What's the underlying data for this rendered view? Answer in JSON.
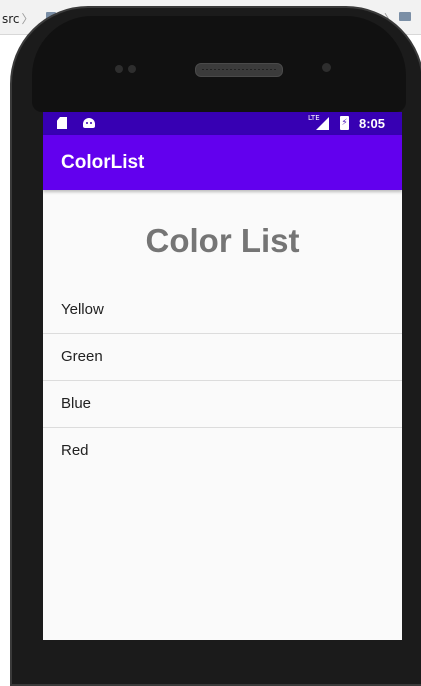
{
  "ide": {
    "breadcrumb": "src",
    "folder_icon": "folder-icon"
  },
  "status_bar": {
    "time": "8:05",
    "network": "LTE",
    "icons": [
      "sim-card-icon",
      "android-debug-icon",
      "signal-icon",
      "battery-charging-icon"
    ]
  },
  "app_bar": {
    "title": "ColorList"
  },
  "main": {
    "heading": "Color List",
    "items": [
      {
        "label": "Yellow"
      },
      {
        "label": "Green"
      },
      {
        "label": "Blue"
      },
      {
        "label": "Red"
      }
    ]
  },
  "colors": {
    "status_bar": "#3700b3",
    "app_bar": "#6200ee",
    "heading_text": "#757575",
    "screen_background": "#fafafa"
  }
}
